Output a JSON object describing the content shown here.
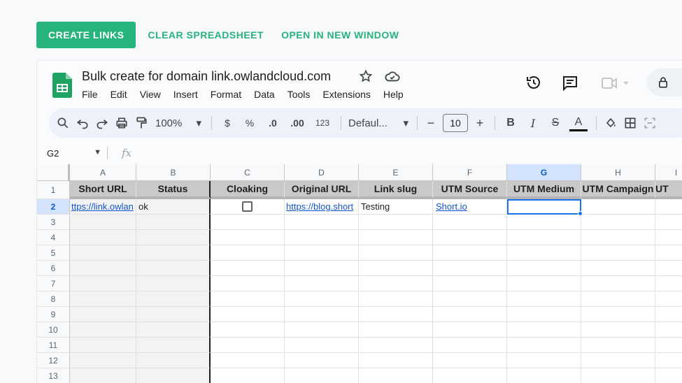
{
  "actions": {
    "create": "CREATE LINKS",
    "clear": "CLEAR SPREADSHEET",
    "open": "OPEN IN NEW WINDOW"
  },
  "doc": {
    "title": "Bulk create for domain link.owlandcloud.com"
  },
  "menu": [
    "File",
    "Edit",
    "View",
    "Insert",
    "Format",
    "Data",
    "Tools",
    "Extensions",
    "Help"
  ],
  "toolbar": {
    "zoom": "100%",
    "currency": "$",
    "percent": "%",
    "dec_less": ".0",
    "dec_more": ".00",
    "number_format": "123",
    "font": "Defaul...",
    "font_size": "10",
    "bold": "B",
    "italic": "I",
    "text_color": "A"
  },
  "formula_bar": {
    "cell_ref": "G2",
    "fx": "fx"
  },
  "columns": [
    "A",
    "B",
    "C",
    "D",
    "E",
    "F",
    "G",
    "H",
    "I"
  ],
  "headers": [
    "Short URL",
    "Status",
    "Cloaking",
    "Original URL",
    "Link slug",
    "UTM Source",
    "UTM Medium",
    "UTM Campaign",
    "UT"
  ],
  "row2": {
    "short_url": "ttps://link.owlan",
    "status": "ok",
    "original_url": "https://blog.short",
    "slug": "Testing",
    "utm_source": "Short.io"
  },
  "row_numbers": [
    "1",
    "2",
    "3",
    "4",
    "5",
    "6",
    "7",
    "8",
    "9",
    "10",
    "11",
    "12",
    "13"
  ]
}
